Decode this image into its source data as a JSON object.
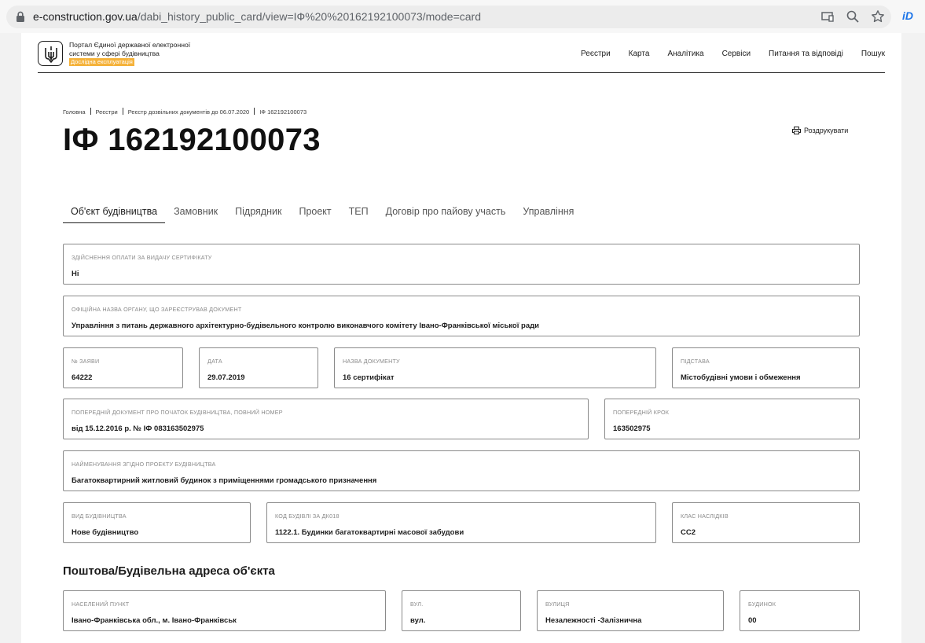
{
  "browser": {
    "url_host": "e-construction.gov.ua",
    "url_path": "/dabi_history_public_card/view=IФ%20%20162192100073/mode=card",
    "extension_label": "iD"
  },
  "header": {
    "portal_title": "Портал Єдиної державної електронної системи у сфері будівництва",
    "beta_badge": "Дослідна експлуатація",
    "nav": [
      "Реєстри",
      "Карта",
      "Аналітика",
      "Сервіси",
      "Питання та відповіді",
      "Пошук"
    ]
  },
  "breadcrumb": [
    "Головна",
    "Реєстри",
    "Реєстр дозвільних документів до 06.07.2020",
    "ІФ 162192100073"
  ],
  "page_title": "ІФ 162192100073",
  "print_label": "Роздрукувати",
  "tabs": [
    "Об'єкт будівництва",
    "Замовник",
    "Підрядник",
    "Проект",
    "ТЕП",
    "Договір про пайову участь",
    "Управління"
  ],
  "fields": {
    "payment": {
      "label": "Здійснення оплати за видачу сертифікату",
      "value": "Ні"
    },
    "authority": {
      "label": "Офіційна назва органу, що зареєстрував документ",
      "value": "Управління з питань державного архітектурно-будівельного контролю виконавчого комітету Івано-Франківської міської ради"
    },
    "app_no": {
      "label": "№ заяви",
      "value": "64222"
    },
    "date": {
      "label": "Дата",
      "value": "29.07.2019"
    },
    "doc_name": {
      "label": "Назва документу",
      "value": "16 сертифікат"
    },
    "basis": {
      "label": "Підстава",
      "value": "Містобудівні умови і обмеження"
    },
    "prev_doc": {
      "label": "Попередній документ про початок будівництва, повний номер",
      "value": "від 15.12.2016 р. № ІФ 083163502975"
    },
    "prev_step": {
      "label": "Попередній крок",
      "value": "163502975"
    },
    "project_name": {
      "label": "Найменування згідно проекту будівництва",
      "value": "Багатоквартирний житловий будинок з приміщеннями громадського призначення"
    },
    "build_type": {
      "label": "Вид будівництва",
      "value": "Нове будівництво"
    },
    "building_code": {
      "label": "Код будівлі за ДК018",
      "value": "1122.1. Будинки багатоквартирні масової забудови"
    },
    "consequence": {
      "label": "Клас наслідків",
      "value": "СС2"
    }
  },
  "address": {
    "title": "Поштова/Будівельна адреса об'єкта",
    "settlement": {
      "label": "Населений пункт",
      "value": "Івано-Франківська обл., м. Івано-Франківськ"
    },
    "street_type": {
      "label": "Вул.",
      "value": "вул."
    },
    "street": {
      "label": "Вулиця",
      "value": "Незалежності -Залізнична"
    },
    "house": {
      "label": "Будинок",
      "value": "00"
    }
  },
  "colors": {
    "accent": "#f5b23a",
    "border": "#8a8a8a",
    "text": "#1d1d1d"
  }
}
